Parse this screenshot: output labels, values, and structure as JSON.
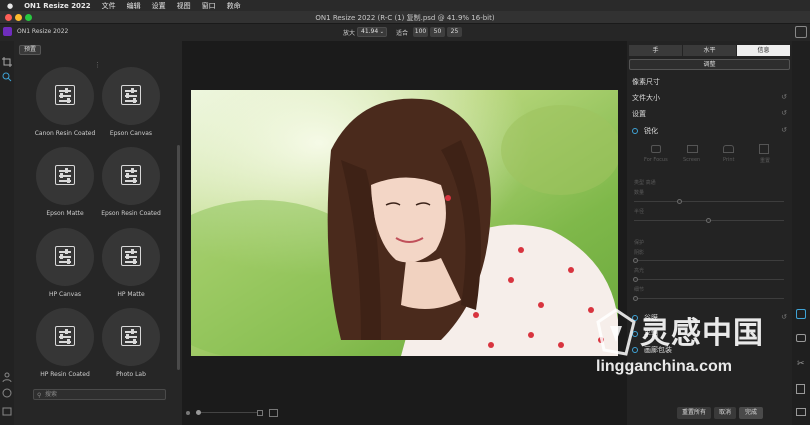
{
  "menubar": {
    "apple": "",
    "app": "ON1 Resize 2022",
    "items": [
      "文件",
      "编辑",
      "设置",
      "视图",
      "窗口",
      "救命"
    ]
  },
  "window": {
    "title": "ON1 Resize 2022 (R-C (1) 复制.psd @ 41.9% 16-bit)"
  },
  "toolbar": {
    "app_name": "ON1 Resize 2022",
    "zoom_label": "放大",
    "zoom_value": "41.94",
    "fit_label": "适合",
    "zoom_presets": [
      "100",
      "50",
      "25"
    ]
  },
  "presets": {
    "tab": "预置",
    "items": [
      "Canon Resin Coated",
      "Epson Canvas",
      "Epson Matte",
      "Epson Resin Coated",
      "HP Canvas",
      "HP Matte",
      "HP Resin Coated",
      "Photo Lab"
    ],
    "search_placeholder": "搜索"
  },
  "right": {
    "segments": [
      "手",
      "水平",
      "信息"
    ],
    "adjust_button": "调整",
    "sections": {
      "pixel_size": "像素尺寸",
      "file_size": "文件大小",
      "settings": "设置",
      "sharpen": "锐化",
      "texture": "谷膜",
      "tile": "平铺",
      "gallery_wrap": "画廊包装"
    },
    "sharpen_modes": [
      "For Focus",
      "Screen",
      "Print",
      "重置"
    ],
    "faded": {
      "type_row": "类型  高通",
      "amount": "数量",
      "radius": "半径",
      "protect": "保护",
      "shadows": "阴影",
      "highlights": "高光",
      "detail": "细节"
    }
  },
  "bottom": {
    "reset_all": "重置所有",
    "cancel": "取消",
    "done": "完成"
  },
  "watermark": {
    "cn": "灵感中国",
    "url": "lingganchina.com"
  },
  "colors": {
    "accent": "#3fa3d6",
    "logo": "#6f2dbd"
  }
}
